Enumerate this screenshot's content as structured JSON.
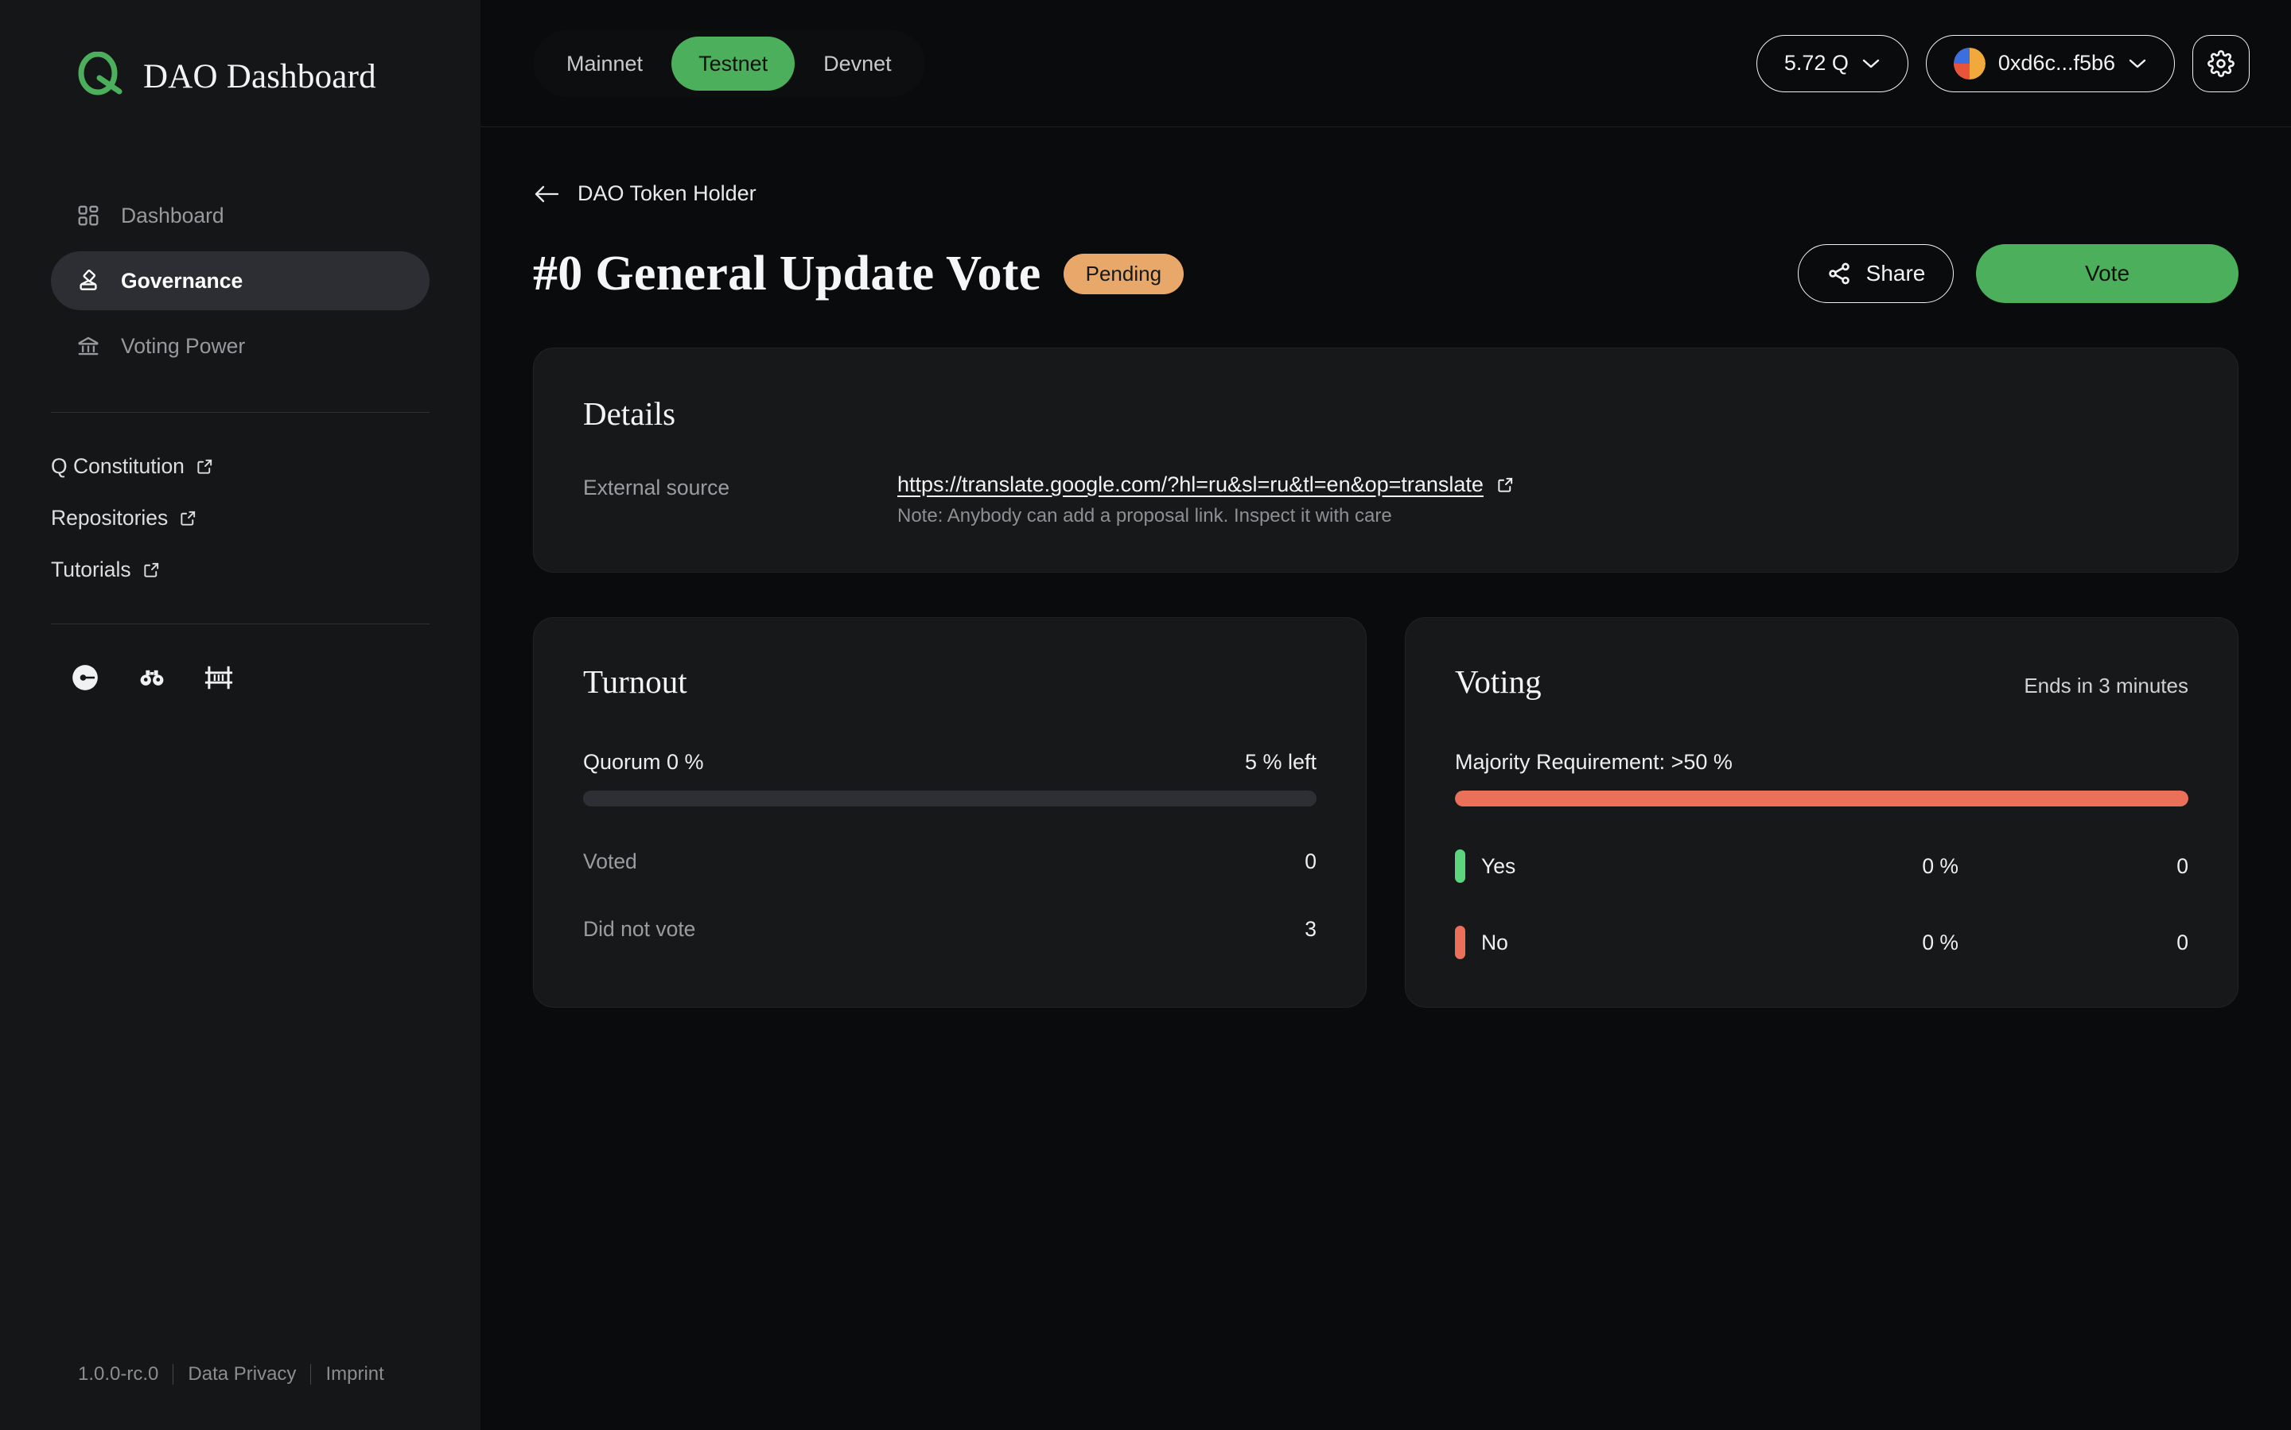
{
  "brand": {
    "title": "DAO Dashboard",
    "logo_icon": "q-logo-icon",
    "accent": "#4caf5b"
  },
  "sidebar": {
    "nav": [
      {
        "label": "Dashboard",
        "icon": "grid-icon",
        "active": false
      },
      {
        "label": "Governance",
        "icon": "ballot-box-icon",
        "active": true
      },
      {
        "label": "Voting Power",
        "icon": "bank-icon",
        "active": false
      }
    ],
    "links": [
      {
        "label": "Q Constitution",
        "icon": "external-link-icon"
      },
      {
        "label": "Repositories",
        "icon": "external-link-icon"
      },
      {
        "label": "Tutorials",
        "icon": "external-link-icon"
      }
    ],
    "socials": [
      {
        "name": "telegram-icon"
      },
      {
        "name": "binoculars-icon"
      },
      {
        "name": "bridge-icon"
      }
    ],
    "footer": {
      "version": "1.0.0-rc.0",
      "data_privacy": "Data Privacy",
      "imprint": "Imprint"
    }
  },
  "topbar": {
    "networks": [
      {
        "label": "Mainnet",
        "active": false
      },
      {
        "label": "Testnet",
        "active": true
      },
      {
        "label": "Devnet",
        "active": false
      }
    ],
    "balance": "5.72 Q",
    "wallet_address": "0xd6c...f5b6",
    "settings_icon": "gear-icon",
    "chevron_icon": "chevron-down-icon"
  },
  "page": {
    "back_label": "DAO Token Holder",
    "back_icon": "arrow-left-icon",
    "title": "#0 General Update Vote",
    "status_badge": "Pending",
    "status_color": "#e8a86a",
    "share_label": "Share",
    "share_icon": "share-icon",
    "vote_label": "Vote"
  },
  "details": {
    "title": "Details",
    "external_source_label": "External source",
    "external_source_url": "https://translate.google.com/?hl=ru&sl=ru&tl=en&op=translate",
    "external_icon": "external-link-icon",
    "note": "Note: Anybody can add a proposal link. Inspect it with care"
  },
  "turnout": {
    "title": "Turnout",
    "quorum_label": "Quorum 0 %",
    "quorum_left": "5 % left",
    "progress_percent": 0,
    "rows": [
      {
        "label": "Voted",
        "value": "0"
      },
      {
        "label": "Did not vote",
        "value": "3"
      }
    ]
  },
  "voting": {
    "title": "Voting",
    "ends_in": "Ends in 3 minutes",
    "majority_label": "Majority Requirement: >50 %",
    "bar_percent": 100,
    "bar_color": "#ea7059",
    "options": [
      {
        "name": "Yes",
        "percent": "0 %",
        "count": "0",
        "color": "#5cd67d"
      },
      {
        "name": "No",
        "percent": "0 %",
        "count": "0",
        "color": "#ea7059"
      }
    ]
  }
}
